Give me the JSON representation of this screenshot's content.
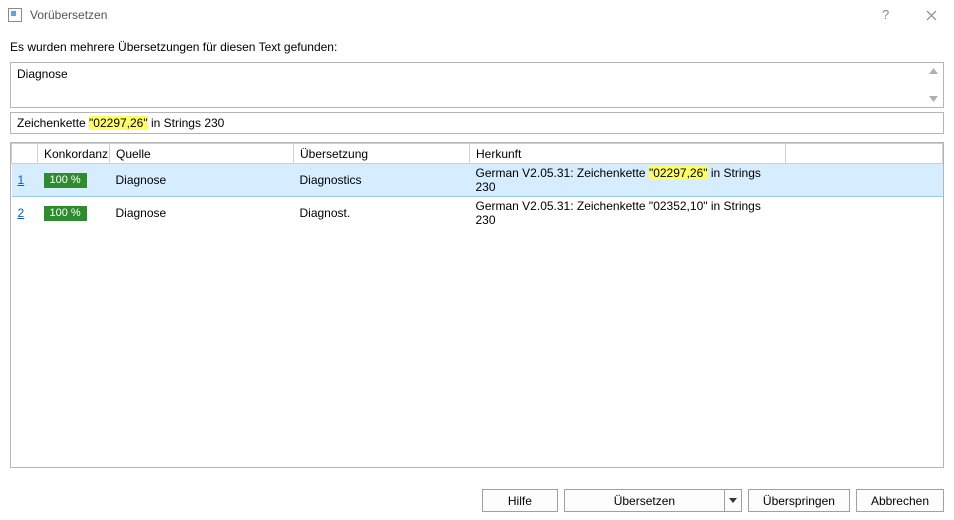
{
  "window": {
    "title": "Vorübersetzen"
  },
  "intro": "Es wurden mehrere Übersetzungen für diesen Text gefunden:",
  "source_text": "Diagnose",
  "context": {
    "prefix": "Zeichenkette ",
    "highlight": "\"02297,26\"",
    "suffix": " in Strings 230"
  },
  "columns": {
    "num": "",
    "match": "Konkordanz",
    "source": "Quelle",
    "target": "Übersetzung",
    "origin": "Herkunft"
  },
  "rows": [
    {
      "num": "1",
      "match": "100 %",
      "source": "Diagnose",
      "target": "Diagnostics",
      "origin_prefix": "German V2.05.31: Zeichenkette ",
      "origin_highlight": "\"02297,26\"",
      "origin_suffix": " in Strings 230",
      "selected": true
    },
    {
      "num": "2",
      "match": "100 %",
      "source": "Diagnose",
      "target": "Diagnost.",
      "origin_prefix": "German V2.05.31: Zeichenkette \"02352,10\" in Strings 230",
      "origin_highlight": "",
      "origin_suffix": "",
      "selected": false
    }
  ],
  "buttons": {
    "help": "Hilfe",
    "translate": "Übersetzen",
    "skip": "Überspringen",
    "cancel": "Abbrechen"
  }
}
